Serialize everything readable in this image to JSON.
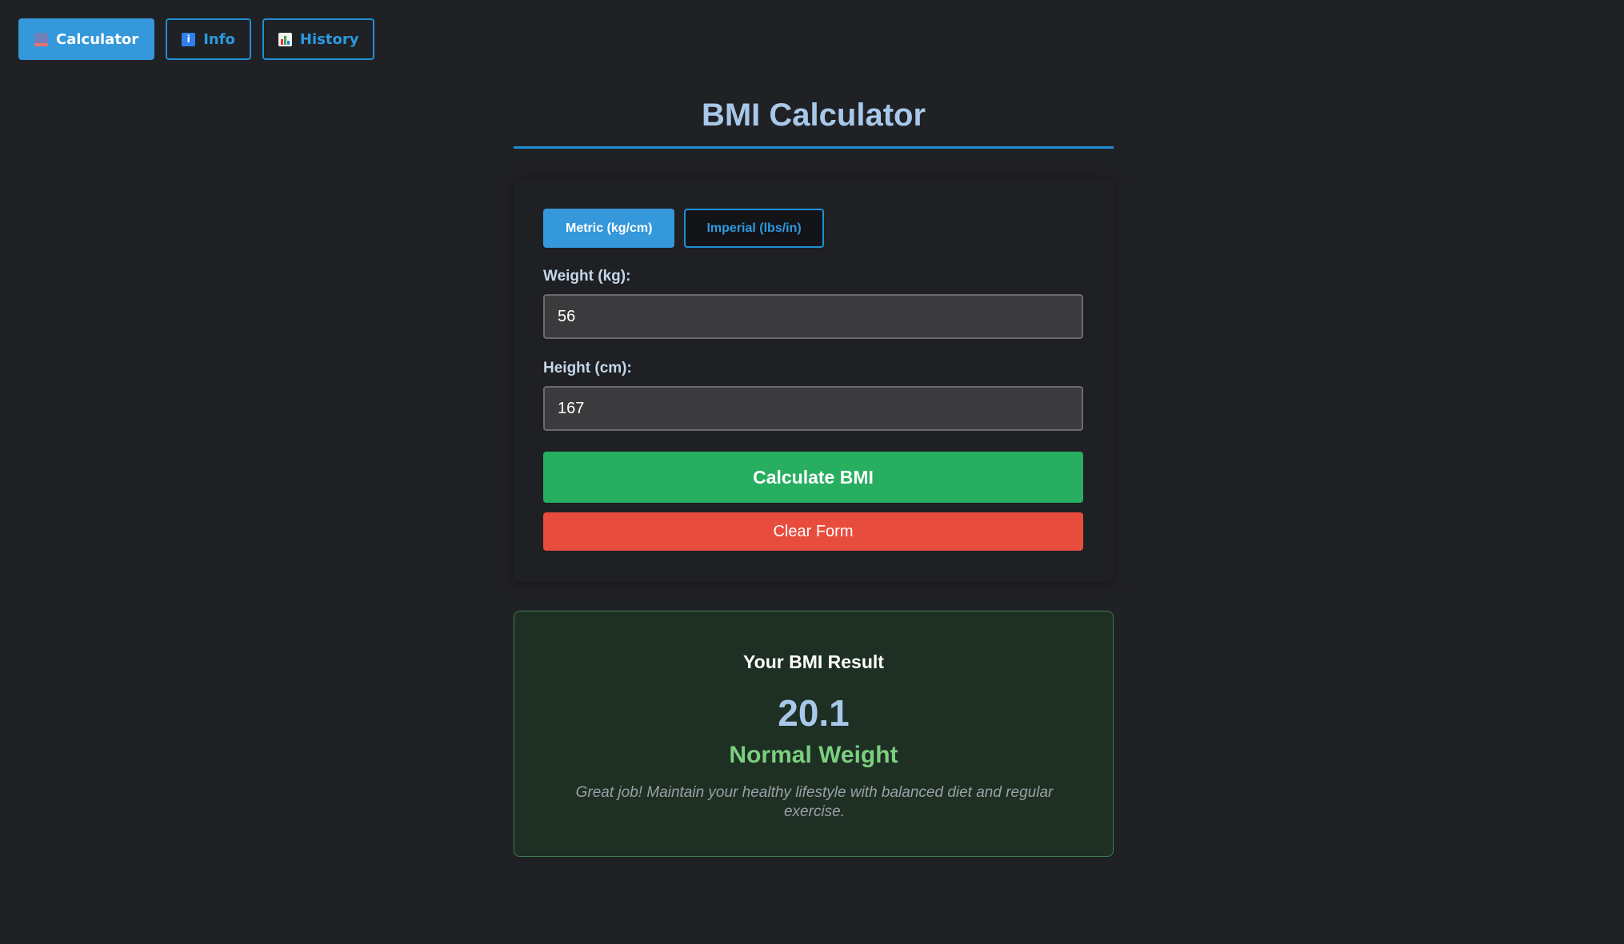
{
  "nav": {
    "tabs": [
      {
        "label": "Calculator",
        "icon": "calculator-icon",
        "active": true
      },
      {
        "label": "Info",
        "icon": "info-icon",
        "active": false
      },
      {
        "label": "History",
        "icon": "bar-chart-icon",
        "active": false
      }
    ]
  },
  "page": {
    "title": "BMI Calculator"
  },
  "form": {
    "units": {
      "metric_label": "Metric (kg/cm)",
      "imperial_label": "Imperial (lbs/in)",
      "selected": "metric"
    },
    "weight": {
      "label": "Weight (kg):",
      "value": "56"
    },
    "height": {
      "label": "Height (cm):",
      "value": "167"
    },
    "calculate_label": "Calculate BMI",
    "clear_label": "Clear Form"
  },
  "result": {
    "heading": "Your BMI Result",
    "value": "20.1",
    "category": "Normal Weight",
    "message": "Great job! Maintain your healthy lifestyle with balanced diet and regular exercise."
  },
  "colors": {
    "background": "#202124",
    "accent": "#3498db",
    "calculate": "#27ae60",
    "clear": "#e74c3c",
    "result_category": "#7ccf7f"
  }
}
